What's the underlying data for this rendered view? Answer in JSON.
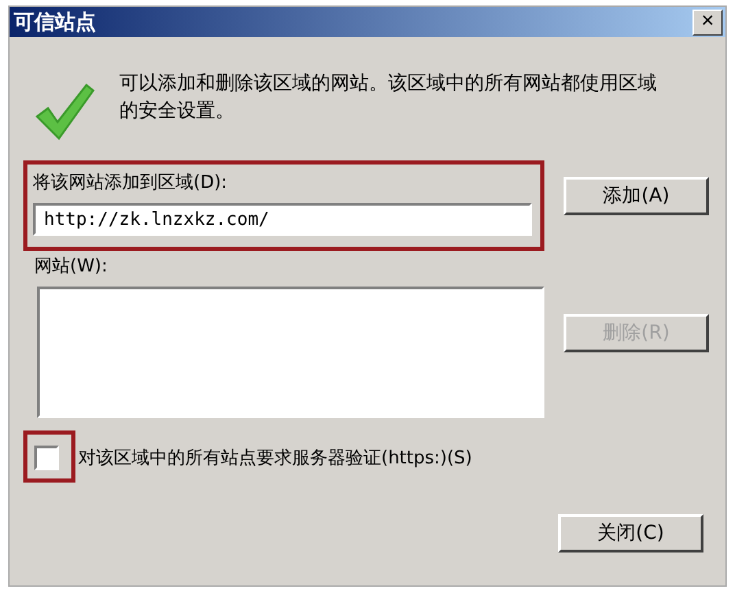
{
  "window": {
    "title": "可信站点",
    "close_label": "×"
  },
  "description": "可以添加和删除该区域的网站。该区域中的所有网站都使用区域的安全设置。",
  "add_site": {
    "label": "将该网站添加到区域(D):",
    "value": "http://zk.lnzxkz.com/",
    "highlighted": true,
    "button": {
      "label": "添加(A)",
      "disabled": false
    }
  },
  "websites": {
    "label": "网站(W):",
    "remove_button": {
      "label": "删除(R)",
      "disabled": true
    }
  },
  "require_https": {
    "label": "对该区域中的所有站点要求服务器验证(https:)(S)",
    "checked": false,
    "highlighted": true
  },
  "buttons": [
    {
      "label": "关闭(C)",
      "disabled": false
    }
  ]
}
